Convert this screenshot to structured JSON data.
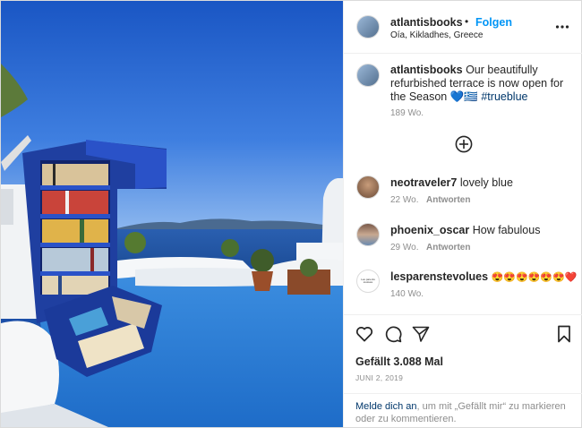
{
  "post": {
    "header": {
      "username": "atlantisbooks",
      "separator": "•",
      "follow_label": "Folgen",
      "location": "Oía, Kikladhes, Greece",
      "more_icon": "more-horizontal-icon"
    },
    "caption": {
      "username": "atlantisbooks",
      "text": "Our beautifully refurbished terrace is now open for the Season",
      "emoji": "💙🇬🇷",
      "hashtag": "#trueblue",
      "age": "189 Wo."
    },
    "load_more_icon": "plus-circle-icon",
    "comments": [
      {
        "username": "neotraveler7",
        "text": "lovely blue",
        "age": "22 Wo.",
        "reply_label": "Antworten"
      },
      {
        "username": "phoenix_oscar",
        "text": "How fabulous",
        "age": "29 Wo.",
        "reply_label": "Antworten"
      },
      {
        "username": "lesparenstevolues",
        "text": "😍😍😍😍😍😍❤️",
        "age": "140 Wo.",
        "reply_label": "",
        "avatar_text": "Les parents évolués"
      }
    ],
    "actions": {
      "icons": [
        "heart-icon",
        "comment-icon",
        "share-icon",
        "bookmark-icon"
      ],
      "likes": "Gefällt 3.088 Mal",
      "date": "JUNI 2, 2019"
    },
    "footer": {
      "login_link": "Melde dich an",
      "rest": ", um mit „Gefällt mir“ zu markieren oder zu kommentieren."
    }
  },
  "colors": {
    "link_blue": "#0095f6",
    "dark_link": "#00376b",
    "muted": "#8e8e8e",
    "border": "#dbdbdb"
  }
}
